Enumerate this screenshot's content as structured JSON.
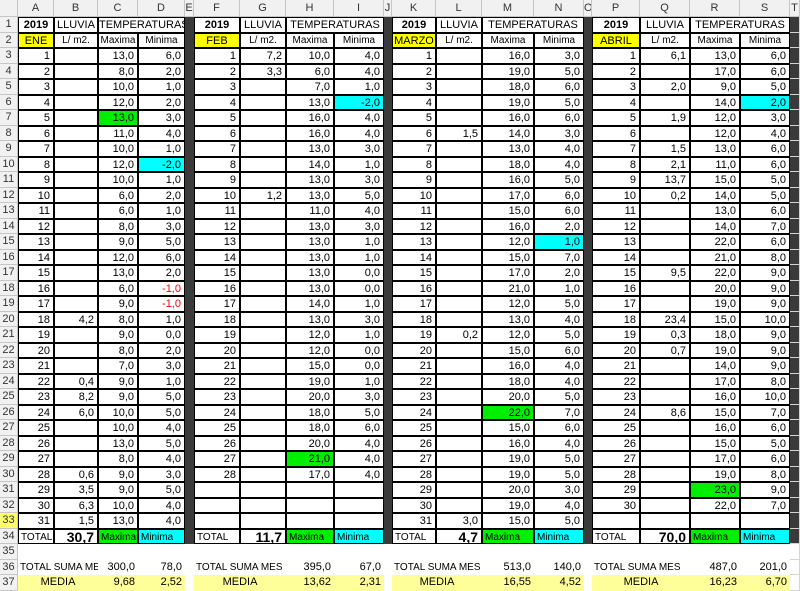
{
  "sheet": {
    "colHeaders": [
      "A",
      "B",
      "C",
      "D",
      "E",
      "F",
      "G",
      "H",
      "I",
      "J",
      "K",
      "L",
      "M",
      "N",
      "O",
      "P",
      "Q",
      "R",
      "S",
      "T"
    ],
    "rowNumbers": [
      "1",
      "2",
      "3",
      "4",
      "5",
      "6",
      "7",
      "8",
      "9",
      "10",
      "11",
      "12",
      "13",
      "14",
      "15",
      "16",
      "17",
      "18",
      "19",
      "20",
      "21",
      "22",
      "23",
      "24",
      "25",
      "26",
      "27",
      "28",
      "29",
      "30",
      "31",
      "32",
      "33",
      "34",
      "35",
      "36",
      "37"
    ],
    "colors": {
      "yellow": "#ffff00",
      "lightYellow": "#ffff99",
      "green": "#00ee00",
      "cyan": "#00ffff",
      "red": "#ff0000"
    },
    "headerLabels": {
      "year": "2019",
      "rain": "LLUVIA",
      "temps": "TEMPERATURAS",
      "unit": "L/ m2.",
      "max": "Maxima",
      "min": "Minima"
    },
    "footerLabels": {
      "total": "TOTAL",
      "totalMes": "TOTAL SUMA MES",
      "media": "MEDIA",
      "max": "Maxima",
      "min": "Minima"
    },
    "months": [
      {
        "name": "ENE",
        "days": [
          "1",
          "2",
          "3",
          "4",
          "5",
          "6",
          "7",
          "8",
          "9",
          "10",
          "11",
          "12",
          "13",
          "14",
          "15",
          "16",
          "17",
          "18",
          "19",
          "20",
          "21",
          "22",
          "23",
          "24",
          "25",
          "26",
          "27",
          "28",
          "29",
          "30",
          "31"
        ],
        "rain": [
          "",
          "",
          "",
          "",
          "",
          "",
          "",
          "",
          "",
          "",
          "",
          "",
          "",
          "",
          "",
          "",
          "",
          "4,2",
          "",
          "",
          "",
          "0,4",
          "8,2",
          "6,0",
          "",
          "",
          "",
          "0,6",
          "3,5",
          "6,3",
          "1,5"
        ],
        "max": [
          "13,0",
          "8,0",
          "10,0",
          "12,0",
          "13,0",
          "11,0",
          "10,0",
          "12,0",
          "10,0",
          "6,0",
          "6,0",
          "8,0",
          "9,0",
          "12,0",
          "13,0",
          "6,0",
          "9,0",
          "8,0",
          "9,0",
          "8,0",
          "7,0",
          "9,0",
          "9,0",
          "10,0",
          "10,0",
          "13,0",
          "8,0",
          "9,0",
          "9,0",
          "10,0",
          "13,0"
        ],
        "min": [
          "6,0",
          "2,0",
          "1,0",
          "2,0",
          "3,0",
          "4,0",
          "1,0",
          "-2,0",
          "1,0",
          "2,0",
          "1,0",
          "3,0",
          "5,0",
          "6,0",
          "2,0",
          "-1,0",
          "-1,0",
          "1,0",
          "0,0",
          "2,0",
          "3,0",
          "1,0",
          "5,0",
          "5,0",
          "4,0",
          "5,0",
          "4,0",
          "3,0",
          "5,0",
          "4,0",
          "4,0"
        ],
        "maxHighlight": 4,
        "minHighlight": 7,
        "redMin": [
          15,
          16
        ],
        "totalRain": "30,7",
        "sumMax": "300,0",
        "sumMin": "78,0",
        "avgMax": "9,68",
        "avgMin": "2,52"
      },
      {
        "name": "FEB",
        "days": [
          "1",
          "2",
          "3",
          "4",
          "5",
          "6",
          "7",
          "8",
          "9",
          "10",
          "11",
          "12",
          "13",
          "14",
          "15",
          "16",
          "17",
          "18",
          "19",
          "20",
          "21",
          "22",
          "23",
          "24",
          "25",
          "26",
          "27",
          "28"
        ],
        "rain": [
          "7,2",
          "3,3",
          "",
          "",
          "",
          "",
          "",
          "",
          "",
          "1,2",
          "",
          "",
          "",
          "",
          "",
          "",
          "",
          "",
          "",
          "",
          "",
          "",
          "",
          "",
          "",
          "",
          "",
          ""
        ],
        "max": [
          "10,0",
          "6,0",
          "7,0",
          "13,0",
          "16,0",
          "16,0",
          "13,0",
          "14,0",
          "13,0",
          "13,0",
          "11,0",
          "13,0",
          "13,0",
          "13,0",
          "13,0",
          "13,0",
          "14,0",
          "13,0",
          "12,0",
          "12,0",
          "15,0",
          "19,0",
          "20,0",
          "18,0",
          "18,0",
          "20,0",
          "21,0",
          "17,0"
        ],
        "min": [
          "4,0",
          "4,0",
          "1,0",
          "-2,0",
          "4,0",
          "4,0",
          "3,0",
          "1,0",
          "3,0",
          "5,0",
          "4,0",
          "3,0",
          "1,0",
          "1,0",
          "0,0",
          "0,0",
          "1,0",
          "3,0",
          "1,0",
          "0,0",
          "0,0",
          "1,0",
          "3,0",
          "5,0",
          "6,0",
          "4,0",
          "4,0",
          "4,0"
        ],
        "maxHighlight": 26,
        "minHighlight": 3,
        "redMin": [],
        "totalRain": "11,7",
        "sumMax": "395,0",
        "sumMin": "67,0",
        "avgMax": "13,62",
        "avgMin": "2,31"
      },
      {
        "name": "MARZO",
        "days": [
          "1",
          "2",
          "3",
          "4",
          "5",
          "6",
          "7",
          "8",
          "9",
          "10",
          "11",
          "12",
          "13",
          "14",
          "15",
          "16",
          "17",
          "18",
          "19",
          "20",
          "21",
          "22",
          "23",
          "24",
          "25",
          "26",
          "27",
          "28",
          "29",
          "30",
          "31"
        ],
        "rain": [
          "",
          "",
          "",
          "",
          "",
          "1,5",
          "",
          "",
          "",
          "",
          "",
          "",
          "",
          "",
          "",
          "",
          "",
          "",
          "0,2",
          "",
          "",
          "",
          "",
          "",
          "",
          "",
          "",
          "",
          "",
          "",
          "3,0"
        ],
        "max": [
          "16,0",
          "19,0",
          "18,0",
          "19,0",
          "16,0",
          "14,0",
          "13,0",
          "18,0",
          "16,0",
          "17,0",
          "15,0",
          "16,0",
          "12,0",
          "15,0",
          "17,0",
          "21,0",
          "12,0",
          "13,0",
          "12,0",
          "15,0",
          "16,0",
          "18,0",
          "20,0",
          "22,0",
          "15,0",
          "16,0",
          "19,0",
          "19,0",
          "20,0",
          "19,0",
          "15,0"
        ],
        "min": [
          "3,0",
          "5,0",
          "6,0",
          "5,0",
          "6,0",
          "3,0",
          "4,0",
          "4,0",
          "5,0",
          "6,0",
          "6,0",
          "2,0",
          "1,0",
          "7,0",
          "2,0",
          "1,0",
          "5,0",
          "4,0",
          "5,0",
          "6,0",
          "4,0",
          "4,0",
          "5,0",
          "7,0",
          "6,0",
          "4,0",
          "5,0",
          "5,0",
          "3,0",
          "4,0",
          "5,0"
        ],
        "maxHighlight": 23,
        "minHighlight": 12,
        "redMin": [],
        "totalRain": "4,7",
        "sumMax": "513,0",
        "sumMin": "140,0",
        "avgMax": "16,55",
        "avgMin": "4,52"
      },
      {
        "name": "ABRIL",
        "days": [
          "1",
          "2",
          "3",
          "4",
          "5",
          "6",
          "7",
          "8",
          "9",
          "10",
          "11",
          "12",
          "13",
          "14",
          "15",
          "16",
          "17",
          "18",
          "19",
          "20",
          "21",
          "22",
          "23",
          "24",
          "25",
          "26",
          "27",
          "28",
          "29",
          "30"
        ],
        "rain": [
          "6,1",
          "",
          "2,0",
          "",
          "1,9",
          "",
          "1,5",
          "2,1",
          "13,7",
          "0,2",
          "",
          "",
          "",
          "",
          "9,5",
          "",
          "",
          "23,4",
          "0,3",
          "0,7",
          "",
          "",
          "",
          "8,6",
          "",
          "",
          "",
          "",
          "",
          ""
        ],
        "max": [
          "13,0",
          "17,0",
          "9,0",
          "14,0",
          "12,0",
          "12,0",
          "13,0",
          "11,0",
          "15,0",
          "14,0",
          "13,0",
          "14,0",
          "22,0",
          "21,0",
          "22,0",
          "20,0",
          "19,0",
          "15,0",
          "18,0",
          "19,0",
          "14,0",
          "17,0",
          "16,0",
          "15,0",
          "16,0",
          "15,0",
          "17,0",
          "19,0",
          "23,0",
          "22,0"
        ],
        "min": [
          "6,0",
          "6,0",
          "5,0",
          "2,0",
          "3,0",
          "4,0",
          "6,0",
          "6,0",
          "5,0",
          "5,0",
          "6,0",
          "7,0",
          "6,0",
          "8,0",
          "9,0",
          "9,0",
          "9,0",
          "10,0",
          "9,0",
          "9,0",
          "9,0",
          "8,0",
          "10,0",
          "7,0",
          "6,0",
          "5,0",
          "6,0",
          "8,0",
          "9,0",
          "7,0"
        ],
        "maxHighlight": 28,
        "minHighlight": 3,
        "redMin": [],
        "totalRain": "70,0",
        "sumMax": "487,0",
        "sumMin": "201,0",
        "avgMax": "16,23",
        "avgMin": "6,70"
      }
    ]
  }
}
